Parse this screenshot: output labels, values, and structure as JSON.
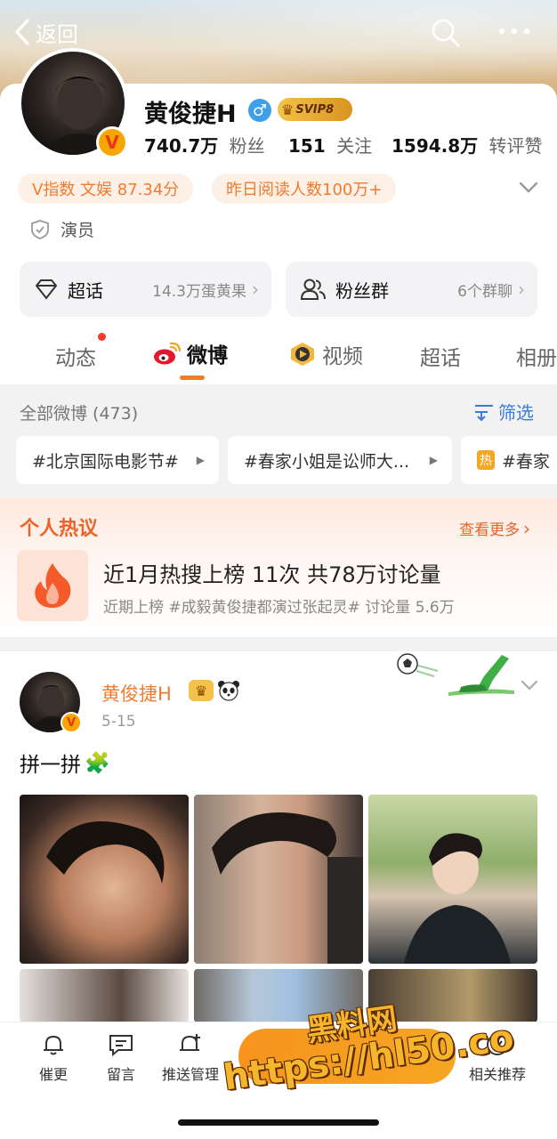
{
  "nav": {
    "back_label": "返回"
  },
  "profile": {
    "name": "黄俊捷H",
    "gender_symbol": "♂",
    "vip_badge": "SVIP8",
    "stats": [
      {
        "value": "740.7万",
        "label": "粉丝"
      },
      {
        "value": "151",
        "label": "关注"
      },
      {
        "value": "1594.8万",
        "label": "转评赞"
      }
    ],
    "tags": [
      "V指数 文娱 87.34分",
      "昨日阅读人数100万+"
    ],
    "occupation": "演员"
  },
  "panels": {
    "super_topic": {
      "label": "超话",
      "detail": "14.3万蛋黄果"
    },
    "fan_group": {
      "label": "粉丝群",
      "detail": "6个群聊"
    }
  },
  "tabs": [
    "动态",
    "微博",
    "视频",
    "超话",
    "相册"
  ],
  "active_tab": "微博",
  "feed_header": {
    "title": "全部微博 (473)",
    "filter_label": "筛选"
  },
  "topic_chips": [
    "#北京国际电影节#",
    "#春家小姐是讼师大...",
    "#春家"
  ],
  "hot_badge": "热",
  "hot_section": {
    "title": "个人热议",
    "more_label": "查看更多",
    "headline": "近1月热搜上榜 11次 共78万讨论量",
    "subline": "近期上榜 #成毅黄俊捷都演过张起灵# 讨论量 5.6万"
  },
  "post": {
    "author": "黄俊捷H",
    "date": "5-15",
    "text": "拼一拼",
    "emoji": "🧩"
  },
  "bottom_bar": {
    "items": [
      "催更",
      "留言",
      "推送管理",
      "相关推荐"
    ]
  },
  "watermark": {
    "line1": "黑料网",
    "line2": "https://hl50.co"
  },
  "colors": {
    "accent": "#f07c2f",
    "orange_bar": "#f7941d",
    "link_blue": "#3a7bd5"
  }
}
